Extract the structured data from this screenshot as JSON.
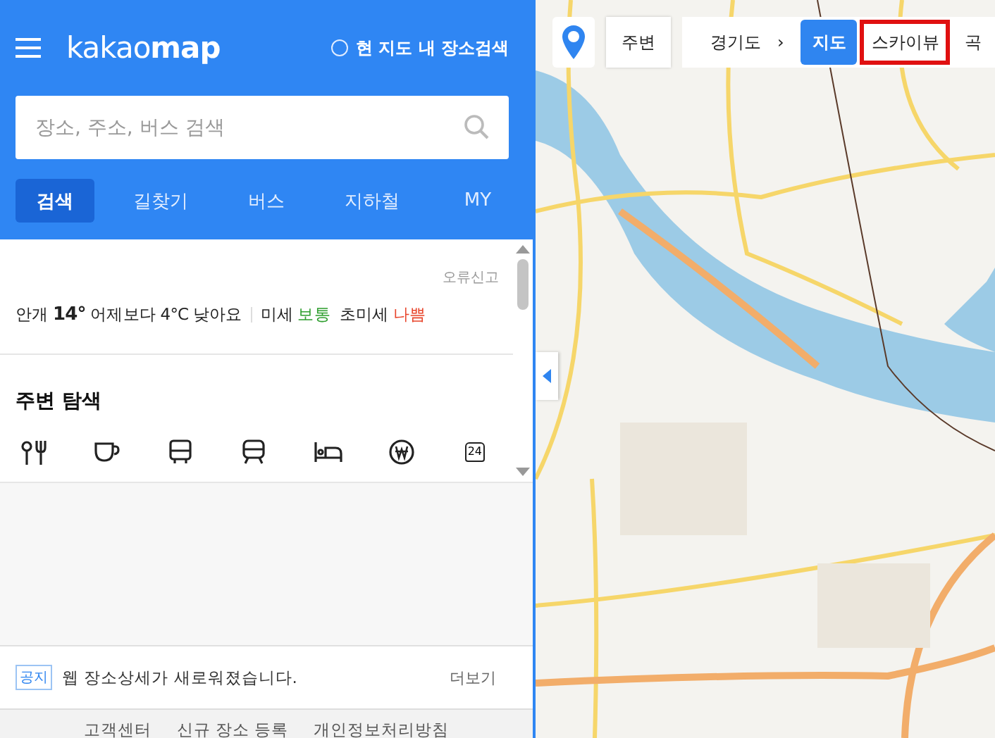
{
  "header": {
    "logo": "kakao**map**",
    "map_search": {
      "label": "현 지도 내 장소검색",
      "checked": false
    }
  },
  "search": {
    "placeholder": "장소, 주소, 버스 검색"
  },
  "tabs": [
    {
      "label": "검색",
      "selected": true
    },
    {
      "label": "길찾기",
      "selected": false
    },
    {
      "label": "버스",
      "selected": false
    },
    {
      "label": "지하철",
      "selected": false
    },
    {
      "label": "MY",
      "selected": false
    }
  ],
  "report": "오류신고",
  "weather": {
    "place": "안개",
    "temp": "14°",
    "compare": "어제보다 4°C 낮아요",
    "air": [
      {
        "label": "미세",
        "value": "보통",
        "color": "#2e9e2e"
      },
      {
        "label": "초미세",
        "value": "나쁨",
        "color": "#e8452c"
      }
    ]
  },
  "nearby": {
    "title": "주변 탐색",
    "categories": [
      {
        "kind": "food"
      },
      {
        "kind": "cafe"
      },
      {
        "kind": "bus"
      },
      {
        "kind": "subway"
      },
      {
        "kind": "hotel"
      },
      {
        "kind": "bank"
      },
      {
        "kind": "store"
      }
    ],
    "store_badge": "24"
  },
  "notice": {
    "badge": "공지",
    "text": "웹 장소상세가 새로워졌습니다.",
    "more": "더보기"
  },
  "footer": [
    "고객센터",
    "신규 장소 등록",
    "개인정보처리방침"
  ],
  "map": {
    "nearby": "주변",
    "region": "경기도",
    "region_arrow": "›",
    "types": [
      {
        "label": "지도",
        "selected": true,
        "highlighted": false
      },
      {
        "label": "스카이뷰",
        "selected": false,
        "highlighted": true
      },
      {
        "label": "곡",
        "selected": false,
        "highlighted": false
      }
    ]
  }
}
